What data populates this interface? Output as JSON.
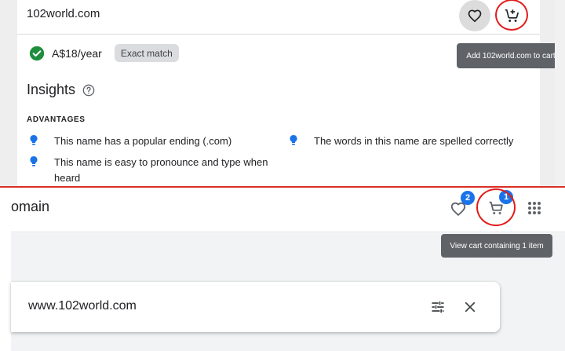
{
  "top_panel": {
    "domain_name": "102world.com",
    "price": "A$18/year",
    "match_label": "Exact match",
    "cart_tooltip": "Add 102world.com to cart",
    "insights_title": "Insights",
    "advantages_heading": "ADVANTAGES",
    "advantages": [
      "This name has a popular ending (.com)",
      "This name is easy to pronounce and type when heard",
      "The words in this name are spelled correctly"
    ]
  },
  "bottom_panel": {
    "app_title": "omain",
    "favorites_count": "2",
    "cart_count": "1",
    "cart_tooltip": "View cart containing 1 item",
    "search_value": "www.102world.com"
  },
  "colors": {
    "accent_blue": "#1a73e8",
    "check_green": "#1e8e3e",
    "highlight_red": "#e31b1b",
    "tooltip_gray": "#5f6368"
  },
  "icons": {
    "favorite": "heart-outline-icon",
    "add_to_cart": "add-shopping-cart-icon",
    "available": "check-circle-icon",
    "help": "help-outline-icon",
    "advantage": "lightbulb-icon",
    "cart": "shopping-cart-icon",
    "apps": "apps-grid-icon",
    "filters": "tune-icon",
    "clear": "close-icon"
  }
}
